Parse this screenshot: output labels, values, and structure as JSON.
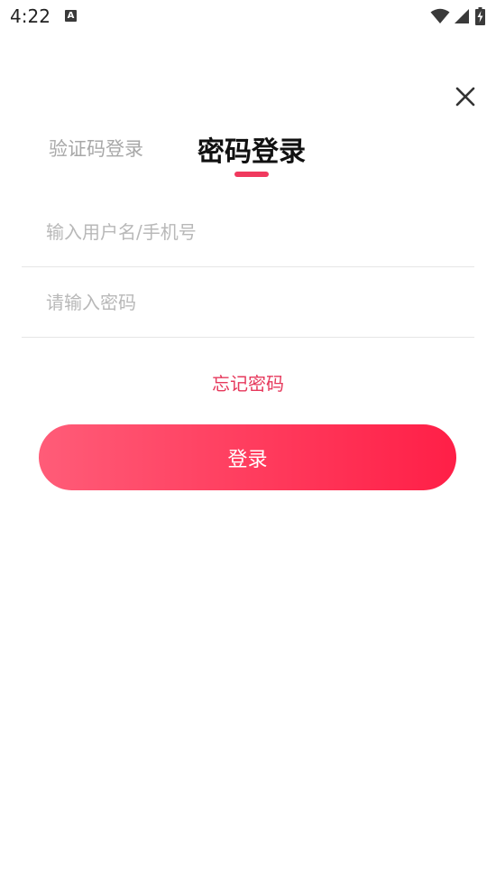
{
  "status_bar": {
    "time": "4:22",
    "notification_glyph": "A"
  },
  "tabs": {
    "sms_login": "验证码登录",
    "password_login": "密码登录",
    "active": "password_login"
  },
  "form": {
    "username_placeholder": "输入用户名/手机号",
    "username_value": "",
    "password_placeholder": "请输入密码",
    "password_value": ""
  },
  "forgot_password": "忘记密码",
  "login_button": "登录",
  "icons": {
    "close": "close-icon",
    "wifi": "wifi-icon",
    "signal": "signal-icon",
    "battery": "battery-charging-icon"
  },
  "colors": {
    "accent": "#f0395e",
    "button_start": "#ff5c78",
    "button_end": "#ff1f47",
    "inactive_tab": "#a8a8a8",
    "divider": "#e6e6e6"
  }
}
